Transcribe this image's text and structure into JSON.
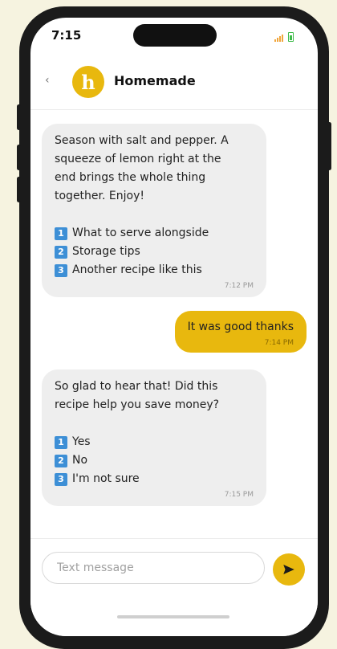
{
  "status_bar": {
    "time": "7:15"
  },
  "header": {
    "back_icon": "chevron-left-icon",
    "avatar_letter": "h",
    "title": "Homemade"
  },
  "messages": [
    {
      "direction": "incoming",
      "lines": [
        "Season with salt and pepper. A",
        "squeeze of lemon right at the",
        "end brings the whole thing",
        "together. Enjoy!"
      ],
      "options": [
        {
          "num": "1",
          "text": "What to serve alongside"
        },
        {
          "num": "2",
          "text": "Storage tips"
        },
        {
          "num": "3",
          "text": "Another recipe like this"
        }
      ],
      "time": "7:12 PM"
    },
    {
      "direction": "outgoing",
      "text": "It was good thanks",
      "time": "7:14 PM"
    },
    {
      "direction": "incoming",
      "lines": [
        "So glad to hear that! Did this",
        "recipe help you save money?"
      ],
      "options": [
        {
          "num": "1",
          "text": "Yes"
        },
        {
          "num": "2",
          "text": "No"
        },
        {
          "num": "3",
          "text": "I'm not sure"
        }
      ],
      "time": "7:15 PM"
    }
  ],
  "composer": {
    "placeholder": "Text message",
    "value": "",
    "send_icon": "send-icon"
  },
  "colors": {
    "accent": "#e8b80e",
    "incoming_bubble": "#eeeeee",
    "option_badge": "#3d8fd6"
  }
}
